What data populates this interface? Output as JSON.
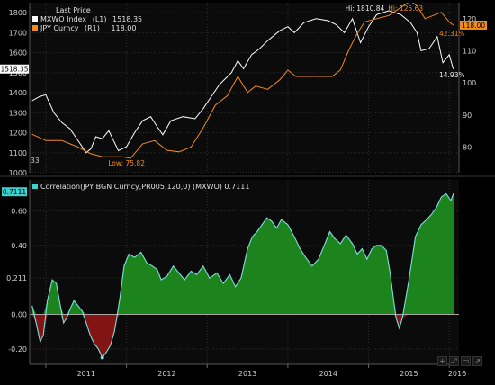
{
  "chart_data": [
    {
      "type": "line",
      "legend": {
        "header": "Last Price",
        "placement": "top-left",
        "entries": [
          {
            "name": "MXWO Index",
            "axis_tag": "(L1)",
            "last": "1518.35",
            "color": "#ffffff"
          },
          {
            "name": "JPY Curncy",
            "axis_tag": "(R1)",
            "last": "118.00",
            "color": "#f08c1e"
          }
        ]
      },
      "y_left": {
        "ticks": [
          "1000",
          "1100",
          "1200",
          "1300",
          "1400",
          "1500",
          "1600",
          "1700",
          "1800"
        ],
        "ylim": [
          1000,
          1850
        ],
        "last_label": "1518.35"
      },
      "y_right": {
        "ticks": [
          "80",
          "90",
          "100",
          "110",
          "120"
        ],
        "ylim": [
          72,
          125
        ],
        "last_label": "118.00"
      },
      "annotations": {
        "mxwo_high": "Hi: 1810.84",
        "jpy_high": "Hi: 125.63",
        "jpy_low": "Low: 75.82",
        "ratio_right": "42.31%",
        "ratio_bottom": "14.93%",
        "corner": "33"
      },
      "grid": true,
      "series": [
        {
          "name": "MXWO Index",
          "axis": "left",
          "x": [
            2010.83,
            2010.92,
            2011.0,
            2011.1,
            2011.2,
            2011.3,
            2011.4,
            2011.5,
            2011.56,
            2011.62,
            2011.7,
            2011.78,
            2011.9,
            2012.0,
            2012.1,
            2012.2,
            2012.3,
            2012.38,
            2012.45,
            2012.55,
            2012.7,
            2012.85,
            2012.95,
            2013.05,
            2013.15,
            2013.3,
            2013.38,
            2013.45,
            2013.55,
            2013.65,
            2013.75,
            2013.9,
            2014.0,
            2014.08,
            2014.2,
            2014.35,
            2014.5,
            2014.6,
            2014.7,
            2014.8,
            2014.9,
            2015.0,
            2015.1,
            2015.25,
            2015.4,
            2015.52,
            2015.6,
            2015.65,
            2015.75,
            2015.85,
            2015.92,
            2016.0,
            2016.05
          ],
          "y": [
            1360,
            1380,
            1390,
            1300,
            1250,
            1220,
            1160,
            1100,
            1120,
            1180,
            1170,
            1210,
            1110,
            1130,
            1200,
            1260,
            1280,
            1230,
            1190,
            1260,
            1280,
            1270,
            1320,
            1380,
            1440,
            1500,
            1560,
            1520,
            1590,
            1620,
            1660,
            1710,
            1730,
            1700,
            1750,
            1770,
            1760,
            1740,
            1700,
            1770,
            1650,
            1730,
            1790,
            1810,
            1790,
            1750,
            1700,
            1610,
            1620,
            1680,
            1550,
            1590,
            1518
          ]
        },
        {
          "name": "JPY Curncy",
          "axis": "right",
          "x": [
            2010.83,
            2011.0,
            2011.2,
            2011.4,
            2011.55,
            2011.7,
            2011.85,
            2011.95,
            2012.05,
            2012.2,
            2012.35,
            2012.5,
            2012.65,
            2012.8,
            2012.95,
            2013.1,
            2013.25,
            2013.38,
            2013.5,
            2013.6,
            2013.75,
            2013.9,
            2014.0,
            2014.1,
            2014.3,
            2014.45,
            2014.55,
            2014.65,
            2014.75,
            2014.85,
            2014.95,
            2015.1,
            2015.25,
            2015.4,
            2015.52,
            2015.6,
            2015.7,
            2015.8,
            2015.9,
            2016.0,
            2016.05
          ],
          "y": [
            84,
            82,
            82,
            80,
            78,
            77,
            77,
            77,
            76.5,
            81,
            82,
            79,
            78.5,
            80,
            86,
            93,
            96,
            102,
            97,
            99,
            98,
            101,
            104,
            102,
            102,
            102,
            102,
            104,
            110,
            115,
            119,
            120,
            121,
            123.5,
            125.5,
            124,
            120,
            121,
            122,
            119,
            118
          ]
        }
      ]
    },
    {
      "type": "area",
      "title": "Correlation(JPY BGN Curncy,PR005,120,0) (MXWO) 0.7111",
      "legend_placement": "top-left",
      "series_name": "Correlation(JPY BGN Curncy,PR005,120,0) (MXWO)",
      "last_value": "0.7111",
      "y_ticks": [
        "0.60",
        "0.40",
        "0.211",
        "0.00",
        "-0.20"
      ],
      "ylim": [
        -0.29,
        0.78
      ],
      "x_labels": [
        "2011",
        "2012",
        "2013",
        "2014",
        "2015",
        "2016"
      ],
      "grid": true,
      "positive_color": "#1f8a1f",
      "negative_color": "#8a1515",
      "line_color": "#7fe0e0",
      "x": [
        2010.83,
        2010.88,
        2010.93,
        2010.97,
        2011.02,
        2011.08,
        2011.13,
        2011.18,
        2011.22,
        2011.26,
        2011.3,
        2011.35,
        2011.4,
        2011.45,
        2011.5,
        2011.55,
        2011.6,
        2011.65,
        2011.7,
        2011.75,
        2011.8,
        2011.85,
        2011.88,
        2011.92,
        2011.97,
        2012.03,
        2012.1,
        2012.18,
        2012.25,
        2012.32,
        2012.38,
        2012.43,
        2012.5,
        2012.58,
        2012.65,
        2012.72,
        2012.8,
        2012.87,
        2012.95,
        2013.03,
        2013.12,
        2013.2,
        2013.28,
        2013.35,
        2013.42,
        2013.5,
        2013.56,
        2013.62,
        2013.68,
        2013.74,
        2013.8,
        2013.86,
        2013.92,
        2014.0,
        2014.08,
        2014.15,
        2014.22,
        2014.3,
        2014.38,
        2014.45,
        2014.52,
        2014.58,
        2014.65,
        2014.72,
        2014.8,
        2014.86,
        2014.92,
        2014.98,
        2015.04,
        2015.1,
        2015.16,
        2015.22,
        2015.27,
        2015.31,
        2015.34,
        2015.38,
        2015.42,
        2015.5,
        2015.58,
        2015.65,
        2015.72,
        2015.78,
        2015.84,
        2015.9,
        2015.96,
        2016.02,
        2016.06
      ],
      "y": [
        0.05,
        -0.05,
        -0.16,
        -0.12,
        0.08,
        0.2,
        0.18,
        0.05,
        -0.05,
        -0.02,
        0.03,
        0.08,
        0.05,
        0.02,
        -0.05,
        -0.12,
        -0.17,
        -0.2,
        -0.25,
        -0.22,
        -0.18,
        -0.1,
        -0.02,
        0.1,
        0.28,
        0.35,
        0.33,
        0.36,
        0.3,
        0.28,
        0.26,
        0.2,
        0.22,
        0.28,
        0.24,
        0.2,
        0.25,
        0.23,
        0.28,
        0.21,
        0.24,
        0.18,
        0.23,
        0.16,
        0.21,
        0.38,
        0.45,
        0.48,
        0.52,
        0.56,
        0.54,
        0.5,
        0.55,
        0.52,
        0.45,
        0.38,
        0.33,
        0.28,
        0.32,
        0.4,
        0.48,
        0.44,
        0.41,
        0.46,
        0.41,
        0.35,
        0.38,
        0.32,
        0.38,
        0.4,
        0.4,
        0.37,
        0.23,
        0.08,
        -0.02,
        -0.08,
        -0.02,
        0.2,
        0.45,
        0.52,
        0.55,
        0.58,
        0.62,
        0.68,
        0.7,
        0.66,
        0.71
      ]
    }
  ],
  "controls": [
    "+",
    "⤢",
    "▭",
    "↗"
  ]
}
